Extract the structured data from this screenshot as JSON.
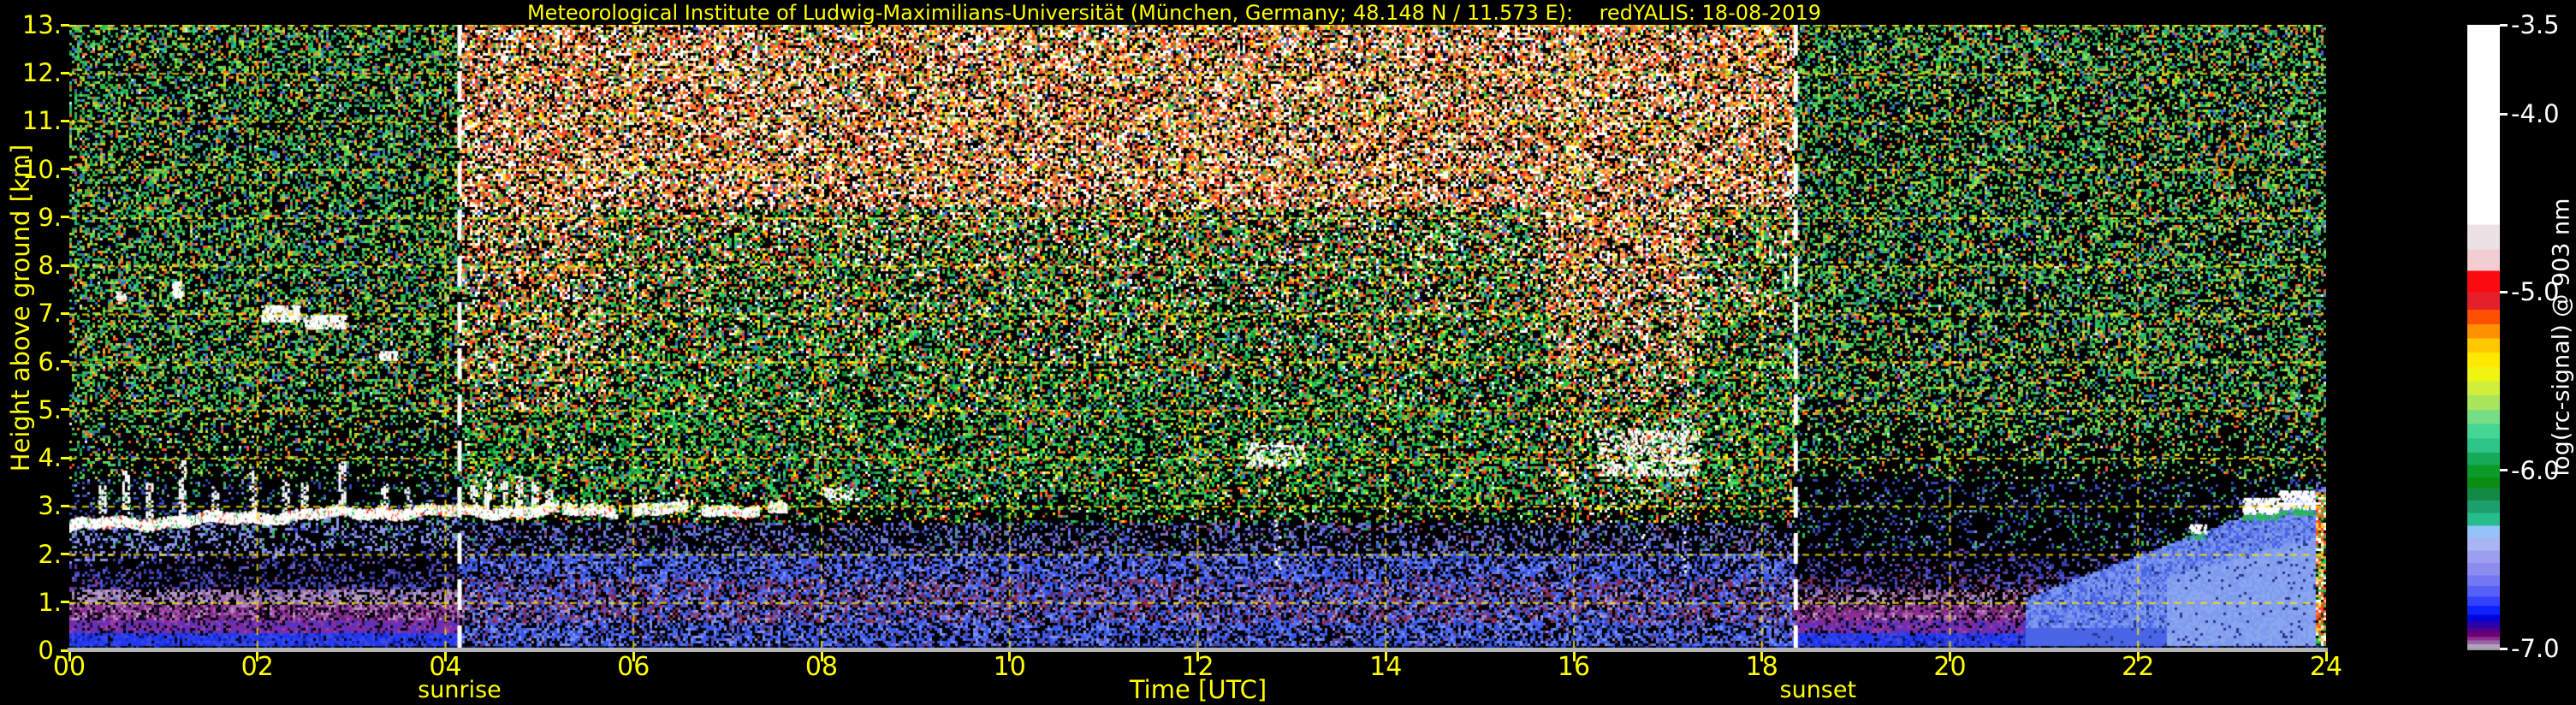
{
  "title": "Meteorological Institute of Ludwig-Maximilians-Universität (München, Germany; 48.148 N / 11.573 E):    redYALIS: 18-08-2019",
  "chart_data": {
    "type": "heatmap",
    "x": {
      "label": "Time [UTC]",
      "range": [
        0,
        24
      ],
      "ticks": [
        {
          "v": 0,
          "label": "00"
        },
        {
          "v": 2,
          "label": "02"
        },
        {
          "v": 4,
          "label": "04"
        },
        {
          "v": 6,
          "label": "06"
        },
        {
          "v": 8,
          "label": "08"
        },
        {
          "v": 10,
          "label": "10"
        },
        {
          "v": 12,
          "label": "12"
        },
        {
          "v": 14,
          "label": "14"
        },
        {
          "v": 16,
          "label": "16"
        },
        {
          "v": 18,
          "label": "18"
        },
        {
          "v": 20,
          "label": "20"
        },
        {
          "v": 22,
          "label": "22"
        },
        {
          "v": 24,
          "label": "24"
        }
      ]
    },
    "y": {
      "label": "Height above ground [km]",
      "range": [
        0,
        13
      ],
      "ticks": [
        {
          "v": 0,
          "label": "0."
        },
        {
          "v": 1,
          "label": "1."
        },
        {
          "v": 2,
          "label": "2."
        },
        {
          "v": 3,
          "label": "3."
        },
        {
          "v": 4,
          "label": "4."
        },
        {
          "v": 5,
          "label": "5."
        },
        {
          "v": 6,
          "label": "6."
        },
        {
          "v": 7,
          "label": "7."
        },
        {
          "v": 8,
          "label": "8."
        },
        {
          "v": 9,
          "label": "9."
        },
        {
          "v": 10,
          "label": "10."
        },
        {
          "v": 11,
          "label": "11."
        },
        {
          "v": 12,
          "label": "12."
        },
        {
          "v": 13,
          "label": "13."
        }
      ]
    },
    "colorbar": {
      "label": "log(rc-signal) @ 903 nm",
      "range": [
        -7.0,
        -3.5
      ],
      "ticks": [
        {
          "v": -3.5,
          "label": "-3.5"
        },
        {
          "v": -4.0,
          "label": "-4.0"
        },
        {
          "v": -5.0,
          "label": "-5.0"
        },
        {
          "v": -6.0,
          "label": "-6.0"
        },
        {
          "v": -7.0,
          "label": "-7.0"
        }
      ],
      "stops": [
        [
          -3.5,
          "#ffffff"
        ],
        [
          -4.62,
          "#ece2e6"
        ],
        [
          -4.76,
          "#f2cdd2"
        ],
        [
          -4.88,
          "#fb0b10"
        ],
        [
          -5.0,
          "#e42028"
        ],
        [
          -5.1,
          "#ff5000"
        ],
        [
          -5.18,
          "#ff9100"
        ],
        [
          -5.26,
          "#ffc801"
        ],
        [
          -5.34,
          "#ffe900"
        ],
        [
          -5.42,
          "#f0f410"
        ],
        [
          -5.5,
          "#d0ee3c"
        ],
        [
          -5.58,
          "#a8e65c"
        ],
        [
          -5.66,
          "#76de84"
        ],
        [
          -5.74,
          "#46d694"
        ],
        [
          -5.82,
          "#2cc489"
        ],
        [
          -5.9,
          "#14aa56"
        ],
        [
          -5.97,
          "#0b9b29"
        ],
        [
          -6.04,
          "#0b8d11"
        ],
        [
          -6.1,
          "#128a45"
        ],
        [
          -6.17,
          "#1ba06d"
        ],
        [
          -6.24,
          "#27bc8b"
        ],
        [
          -6.31,
          "#95c3f8"
        ],
        [
          -6.38,
          "#a9b5f3"
        ],
        [
          -6.45,
          "#9e9ef1"
        ],
        [
          -6.52,
          "#8c8cf0"
        ],
        [
          -6.59,
          "#7377f2"
        ],
        [
          -6.65,
          "#5560f6"
        ],
        [
          -6.71,
          "#3241fc"
        ],
        [
          -6.76,
          "#0e22fe"
        ],
        [
          -6.81,
          "#0105dc"
        ],
        [
          -6.85,
          "#2d01a8"
        ],
        [
          -6.885,
          "#4f0187"
        ],
        [
          -6.91,
          "#700070"
        ],
        [
          -6.935,
          "#8a2f91"
        ],
        [
          -6.955,
          "#9a64a8"
        ],
        [
          -6.975,
          "#b3a2bd"
        ]
      ]
    },
    "sun": [
      {
        "label": "sunrise",
        "time_utc": 4.15
      },
      {
        "label": "sunset",
        "time_utc": 18.36
      }
    ],
    "grid": {
      "x_step_hours": 2,
      "y_step_km": 1,
      "style": "yellow dashed"
    },
    "features": {
      "cloud_deck": {
        "t_start": 0,
        "t_end": 7.65,
        "base_km": 2.6,
        "top_km": 3.0
      },
      "turrets": [
        [
          0.35,
          3.45
        ],
        [
          0.6,
          3.75
        ],
        [
          0.85,
          3.5
        ],
        [
          1.2,
          3.95
        ],
        [
          1.55,
          3.4
        ],
        [
          1.95,
          3.75
        ],
        [
          2.3,
          3.6
        ],
        [
          2.5,
          3.5
        ],
        [
          2.9,
          3.95
        ],
        [
          3.35,
          3.45
        ],
        [
          3.6,
          3.4
        ],
        [
          4.3,
          3.55
        ],
        [
          4.45,
          3.7
        ],
        [
          4.62,
          3.5
        ],
        [
          4.78,
          3.65
        ],
        [
          4.95,
          3.45
        ],
        [
          5.1,
          3.35
        ],
        [
          6.1,
          3.3
        ],
        [
          6.5,
          3.25
        ]
      ],
      "high_clouds": [
        [
          2.05,
          2.45,
          6.85,
          7.15
        ],
        [
          2.5,
          2.95,
          6.7,
          6.95
        ],
        [
          3.3,
          3.5,
          6.05,
          6.2
        ],
        [
          1.1,
          1.2,
          7.35,
          7.65
        ],
        [
          0.5,
          0.62,
          7.3,
          7.45
        ]
      ],
      "day_cloud_dots": [
        [
          7.98,
          8.4,
          3.1,
          3.35
        ],
        [
          12.5,
          13.15,
          3.85,
          4.3
        ],
        [
          16.25,
          17.35,
          3.65,
          4.55
        ]
      ],
      "evening_cloud_caps": [
        [
          22.55,
          22.72,
          2.45,
          2.62
        ],
        [
          23.12,
          23.5,
          2.85,
          3.15
        ],
        [
          23.5,
          23.88,
          2.95,
          3.3
        ]
      ],
      "noise_streaks": [
        [
          12.85,
          0.3
        ],
        [
          17.16,
          0.3
        ],
        [
          16.73,
          0.12
        ]
      ],
      "contrail_scribble": [
        22.8,
        23.3,
        9.3,
        10.85
      ],
      "evening_fan": {
        "t_start": 20.8,
        "top_km_at_24": 3.4
      },
      "edge_echo_t": 23.9
    },
    "palettes": {
      "day_top": [
        [
          0.24,
          "#ffffff"
        ],
        [
          0.13,
          "#ff4028"
        ],
        [
          0.13,
          "#ff8030"
        ],
        [
          0.09,
          "#ffc070"
        ],
        [
          0.07,
          "#a87040"
        ],
        [
          0.05,
          "#50b840"
        ],
        [
          0.04,
          "#ffe800"
        ],
        [
          0.02,
          "#4060d0"
        ]
      ],
      "day_mid": [
        [
          0.16,
          "#28c048"
        ],
        [
          0.08,
          "#60dc60"
        ],
        [
          0.1,
          "#108834"
        ],
        [
          0.05,
          "#ffe400"
        ],
        [
          0.045,
          "#ff7020"
        ],
        [
          0.03,
          "#ff3010"
        ],
        [
          0.02,
          "#ffffff"
        ],
        [
          0.04,
          "#4068d8"
        ],
        [
          0.03,
          "#20c8a0"
        ]
      ],
      "night_up": [
        [
          0.16,
          "#2eba4e"
        ],
        [
          0.1,
          "#66d45e"
        ],
        [
          0.075,
          "#c6da22"
        ],
        [
          0.065,
          "#1e925a"
        ],
        [
          0.04,
          "#ff5022"
        ],
        [
          0.03,
          "#ff9422"
        ],
        [
          0.05,
          "#4462de"
        ],
        [
          0.03,
          "#1cc6a6"
        ],
        [
          0.008,
          "#e8e8e8"
        ]
      ],
      "day_low": [
        [
          0.16,
          "#6e80e2"
        ],
        [
          0.1,
          "#3c50c8"
        ],
        [
          0.04,
          "#8c5c9c"
        ],
        [
          0.03,
          "#28a060"
        ],
        [
          0.03,
          "#7c2c52"
        ]
      ],
      "day_bl_maroon": [
        [
          0.2,
          "#3a58e8"
        ],
        [
          0.1,
          "#5c74f0"
        ],
        [
          0.08,
          "#8292ec"
        ],
        [
          0.17,
          "#7c2c52"
        ],
        [
          0.06,
          "#a23a66"
        ],
        [
          0.05,
          "#b49cc2"
        ],
        [
          0.05,
          "#2840a0"
        ]
      ],
      "day_bl_blue": [
        [
          0.3,
          "#3a58e8"
        ],
        [
          0.14,
          "#5c74f0"
        ],
        [
          0.1,
          "#8292ec"
        ],
        [
          0.04,
          "#7c2c52"
        ],
        [
          0.04,
          "#2840a0"
        ]
      ],
      "night_low_sparse": [
        [
          0.1,
          "#3448bc"
        ],
        [
          0.05,
          "#2eba4e"
        ],
        [
          0.025,
          "#8090e0"
        ]
      ],
      "n_band_bottom": [
        [
          0.5,
          "#2238ee"
        ],
        [
          0.16,
          "#3348f4"
        ],
        [
          0.12,
          "#1226c8"
        ],
        [
          0.12,
          "#4848c8"
        ],
        [
          0.05,
          "#0a1668"
        ]
      ],
      "n_band_purple": [
        [
          0.32,
          "#6a30b4"
        ],
        [
          0.22,
          "#8a28a0"
        ],
        [
          0.14,
          "#4a34cc"
        ],
        [
          0.1,
          "#a040a0"
        ],
        [
          0.12,
          "#201040"
        ]
      ],
      "n_band_magenta": [
        [
          0.3,
          "#8c2c94"
        ],
        [
          0.18,
          "#a85ca8"
        ],
        [
          0.14,
          "#b894c4"
        ],
        [
          0.1,
          "#6a2880"
        ],
        [
          0.14,
          "#140a28"
        ]
      ],
      "n_band_mauve": [
        [
          0.24,
          "#b49cc4"
        ],
        [
          0.15,
          "#a878b0"
        ],
        [
          0.12,
          "#8c5c9c"
        ],
        [
          0.07,
          "#7080d0"
        ],
        [
          0.05,
          "#803890"
        ]
      ],
      "n_band_navy": [
        [
          0.2,
          "#343cae"
        ],
        [
          0.11,
          "#4c50d0"
        ],
        [
          0.08,
          "#6c60c0"
        ],
        [
          0.05,
          "#803890"
        ]
      ],
      "bottom_row": [
        [
          0.3,
          "#101a50"
        ],
        [
          0.25,
          "#2034d0"
        ],
        [
          0.25,
          "#000000"
        ],
        [
          0.2,
          "#0a1230"
        ]
      ],
      "fan_blues": [
        "#4a66e6",
        "#6a86ea",
        "#7e9aee",
        "#8aa6f0",
        "#5a76e8"
      ],
      "edge_echo": [
        [
          0.22,
          "#ffffff"
        ],
        [
          0.18,
          "#2ec24e"
        ],
        [
          0.16,
          "#ff4422"
        ],
        [
          0.12,
          "#ffd040"
        ],
        [
          0.1,
          "#ff8820"
        ],
        [
          0.12,
          "#104010"
        ]
      ],
      "cloud_white": [
        [
          0.78,
          "#ffffff"
        ],
        [
          0.08,
          "#ffe0d0"
        ],
        [
          0.07,
          "#30c860"
        ],
        [
          0.07,
          "#ff4030"
        ]
      ],
      "contrail": [
        [
          0.5,
          "#ff8820"
        ],
        [
          0.25,
          "#ff5010"
        ],
        [
          0.15,
          "#ffb040"
        ],
        [
          0.05,
          "#ffffff"
        ]
      ],
      "grid_color": "rgba(255,230,0,0.85)",
      "sun_line_color": "#ffffff",
      "accent_yellow": "#ffff00"
    }
  }
}
